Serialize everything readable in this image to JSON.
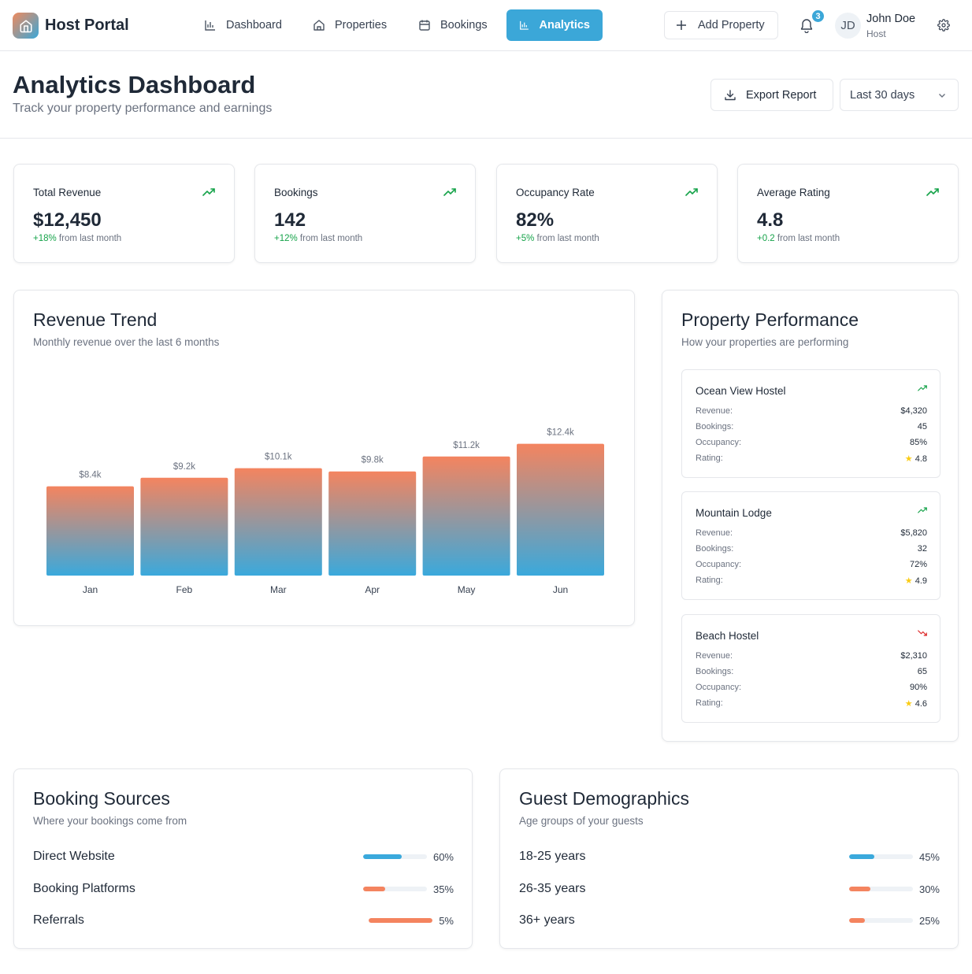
{
  "brand": "Host Portal",
  "nav": {
    "items": [
      {
        "label": "Dashboard",
        "icon": "bar-chart-icon"
      },
      {
        "label": "Properties",
        "icon": "home-icon"
      },
      {
        "label": "Bookings",
        "icon": "calendar-icon"
      },
      {
        "label": "Analytics",
        "icon": "bar-chart-icon",
        "active": true
      }
    ],
    "add_property": "Add Property",
    "notifications": "3",
    "user": {
      "initials": "JD",
      "name": "John Doe",
      "role": "Host"
    }
  },
  "header": {
    "title": "Analytics Dashboard",
    "subtitle": "Track your property performance and earnings",
    "export": "Export Report",
    "range": "Last 30 days"
  },
  "stats": [
    {
      "title": "Total Revenue",
      "value": "$12,450",
      "change": "+18%",
      "change_text": " from last month"
    },
    {
      "title": "Bookings",
      "value": "142",
      "change": "+12%",
      "change_text": " from last month"
    },
    {
      "title": "Occupancy Rate",
      "value": "82%",
      "change": "+5%",
      "change_text": " from last month"
    },
    {
      "title": "Average Rating",
      "value": "4.8",
      "change": "+0.2",
      "change_text": " from last month"
    }
  ],
  "revenue": {
    "title": "Revenue Trend",
    "subtitle": "Monthly revenue over the last 6 months"
  },
  "chart_data": {
    "type": "bar",
    "categories": [
      "Jan",
      "Feb",
      "Mar",
      "Apr",
      "May",
      "Jun"
    ],
    "values": [
      8.4,
      9.2,
      10.1,
      9.8,
      11.2,
      12.4
    ],
    "data_labels": [
      "$8.4k",
      "$9.2k",
      "$10.1k",
      "$9.8k",
      "$11.2k",
      "$12.4k"
    ],
    "title": "Revenue Trend",
    "xlabel": "",
    "ylabel": "",
    "colors": {
      "top": "#f4845f",
      "bottom": "#3aa9dc"
    }
  },
  "performance": {
    "title": "Property Performance",
    "subtitle": "How your properties are performing",
    "labels": {
      "revenue": "Revenue:",
      "bookings": "Bookings:",
      "occupancy": "Occupancy:",
      "rating": "Rating:"
    },
    "properties": [
      {
        "name": "Ocean View Hostel",
        "trend": "up",
        "revenue": "$4,320",
        "bookings": "45",
        "occupancy": "85%",
        "rating": "4.8"
      },
      {
        "name": "Mountain Lodge",
        "trend": "up",
        "revenue": "$5,820",
        "bookings": "32",
        "occupancy": "72%",
        "rating": "4.9"
      },
      {
        "name": "Beach Hostel",
        "trend": "down",
        "revenue": "$2,310",
        "bookings": "65",
        "occupancy": "90%",
        "rating": "4.6"
      }
    ]
  },
  "sources": {
    "title": "Booking Sources",
    "subtitle": "Where your bookings come from",
    "items": [
      {
        "label": "Direct Website",
        "value": "60%",
        "fill": 0.6,
        "color": "#3aa9dc"
      },
      {
        "label": "Booking Platforms",
        "value": "35%",
        "fill": 0.35,
        "color": "#f4845f"
      },
      {
        "label": "Referrals",
        "value": "5%",
        "fill": 1.0,
        "color": "#f4845f"
      }
    ]
  },
  "demographics": {
    "title": "Guest Demographics",
    "subtitle": "Age groups of your guests",
    "items": [
      {
        "label": "18-25 years",
        "value": "45%",
        "fill": 0.4,
        "color": "#3aa9dc"
      },
      {
        "label": "26-35 years",
        "value": "30%",
        "fill": 0.33,
        "color": "#f4845f"
      },
      {
        "label": "36+ years",
        "value": "25%",
        "fill": 0.25,
        "color": "#f4845f"
      }
    ]
  }
}
